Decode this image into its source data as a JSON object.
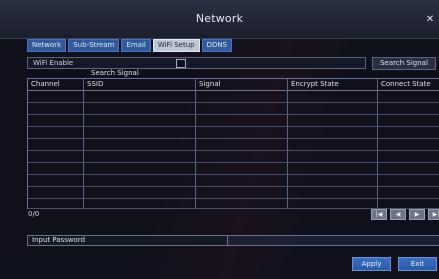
{
  "window": {
    "title": "Network"
  },
  "tabs": [
    {
      "label": "Network"
    },
    {
      "label": "Sub-Stream"
    },
    {
      "label": "Email"
    },
    {
      "label": "WiFi Setup",
      "active": true
    },
    {
      "label": "DDNS"
    }
  ],
  "wifi": {
    "enable_label": "WiFi Enable",
    "enabled": false,
    "search_signal_button": "Search Signal",
    "search_signal_label": "Search Signal"
  },
  "table": {
    "columns": [
      "Channel",
      "SSID",
      "Signal",
      "Encrypt State",
      "Connect State"
    ],
    "rows": []
  },
  "pager": {
    "count_text": "0/0",
    "buttons": [
      "first",
      "prev",
      "next",
      "last"
    ]
  },
  "password": {
    "label": "Input Password",
    "value": ""
  },
  "actions": {
    "apply_label": "Apply",
    "exit_label": "Exit"
  },
  "colors": {
    "tab": "#2f5a9c",
    "tab_active": "#bfc7d6",
    "button": "#2a5aa6"
  }
}
